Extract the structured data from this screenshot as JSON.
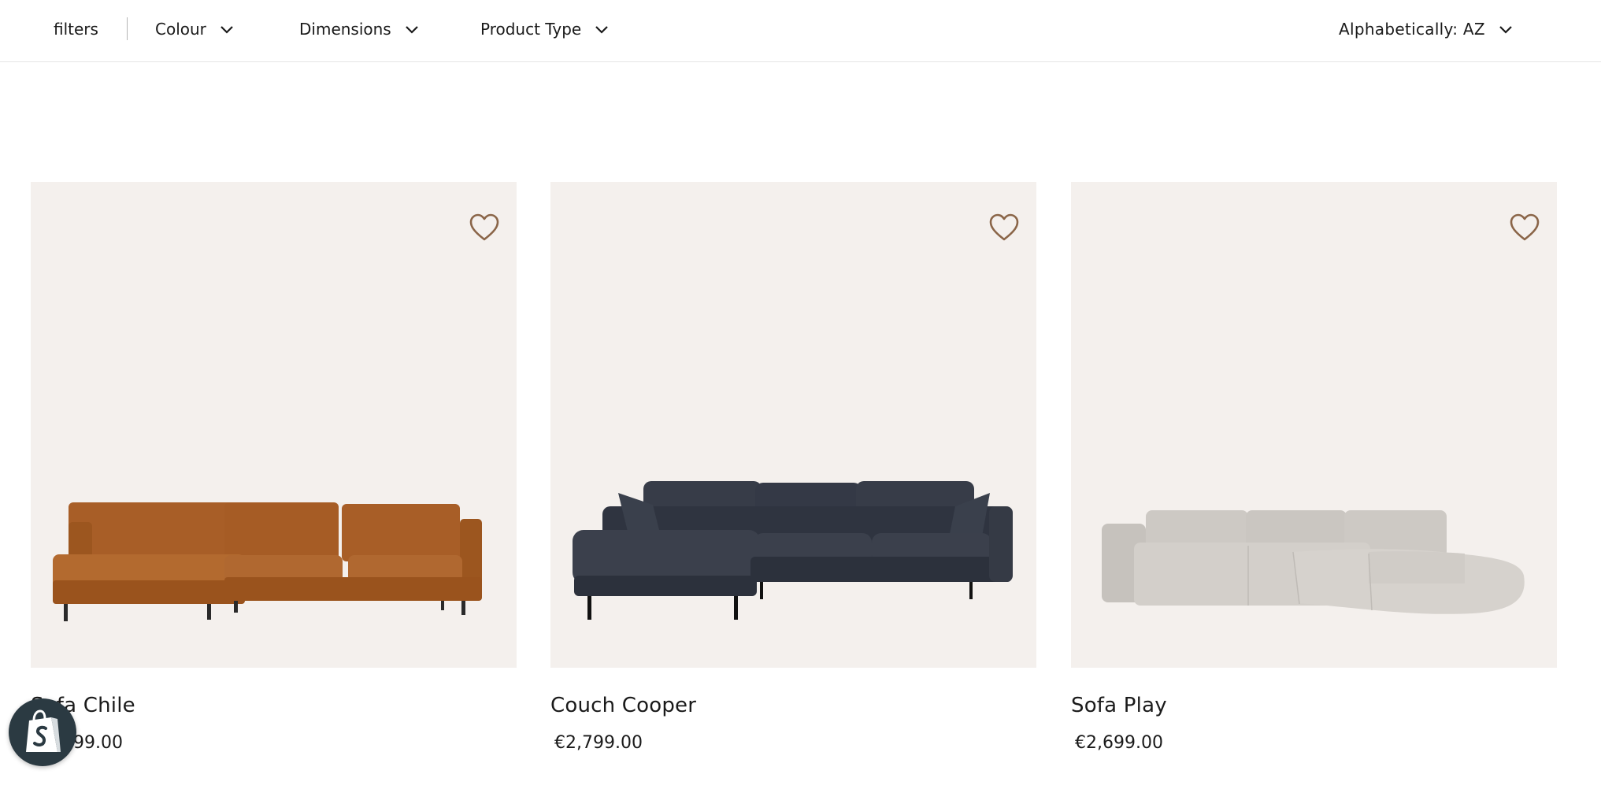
{
  "filters": {
    "label": "filters",
    "items": [
      {
        "label": "Colour"
      },
      {
        "label": "Dimensions"
      },
      {
        "label": "Product Type"
      }
    ],
    "sort_label": "Alphabetically: AZ",
    "chevron_icon": "chevron-down-icon"
  },
  "products": [
    {
      "name": "Sofa Chile",
      "price": "€2,799.00",
      "image": "tan-leather-corner-sofa",
      "color": "#b0662c"
    },
    {
      "name": "Couch Cooper",
      "price": "€2,799.00",
      "image": "dark-navy-corner-couch",
      "color": "#363b47"
    },
    {
      "name": "Sofa Play",
      "price": "€2,699.00",
      "image": "light-grey-curved-sofa",
      "color": "#d3cfca"
    }
  ],
  "colors": {
    "card_background": "#f4f0ed",
    "wishlist_icon": "#8a6548",
    "badge": "#2b3a42"
  },
  "icons": {
    "wishlist": "heart-outline-icon",
    "badge": "shopify-bag-icon"
  }
}
